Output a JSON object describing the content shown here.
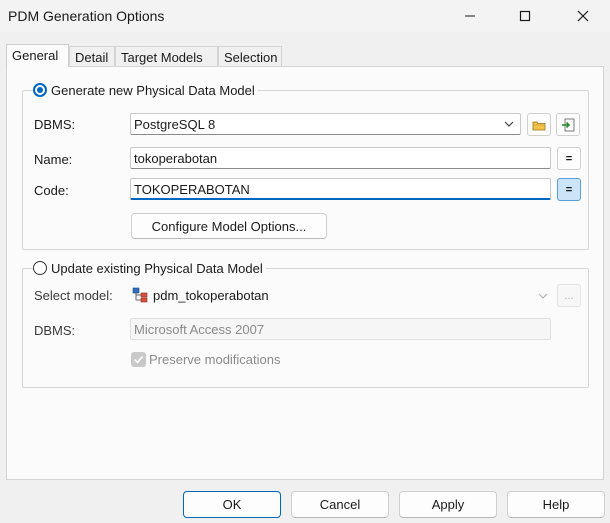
{
  "window": {
    "title": "PDM Generation Options",
    "minimize_glyph": "—",
    "maximize_glyph": "☐",
    "close_glyph": "✕"
  },
  "tabs": [
    "General",
    "Detail",
    "Target Models",
    "Selection"
  ],
  "active_tab": "General",
  "generate_new": {
    "label": "Generate new Physical Data Model",
    "selected": true,
    "dbms_label": "DBMS:",
    "dbms_value": "PostgreSQL 8",
    "name_label": "Name:",
    "name_value": "tokoperabotan",
    "code_label": "Code:",
    "code_value": "TOKOPERABOTAN",
    "eq_symbol": "=",
    "configure_button": "Configure Model Options..."
  },
  "update_existing": {
    "label": "Update existing Physical Data Model",
    "selected": false,
    "select_model_label": "Select model:",
    "select_model_value": "pdm_tokoperabotan",
    "ellipsis": "...",
    "dbms_label": "DBMS:",
    "dbms_value": "Microsoft Access 2007",
    "preserve_label": "Preserve modifications",
    "preserve_checked": true
  },
  "buttons": {
    "ok": "OK",
    "cancel": "Cancel",
    "apply": "Apply",
    "help": "Help"
  },
  "icons": {
    "dbms_browse": "folder-icon",
    "dbms_properties": "import-icon",
    "model": "model-tree-icon",
    "dropdown": "chevron-down-icon"
  },
  "colors": {
    "accent": "#0067c0",
    "pressed": "#cce4f7",
    "window_bg": "#f0f0f0"
  }
}
